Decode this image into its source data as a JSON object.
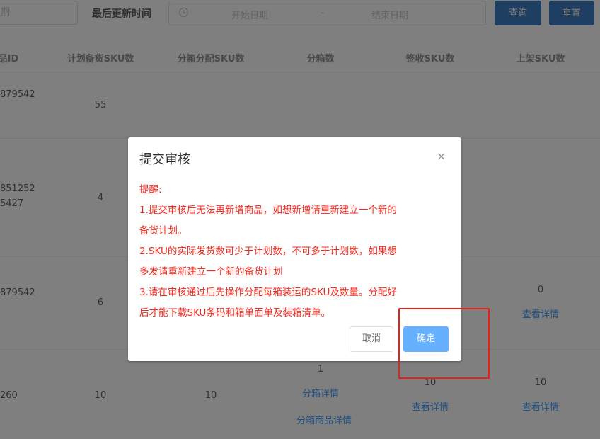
{
  "filter": {
    "partial_input": "期",
    "update_time_label": "最后更新时间",
    "start_placeholder": "开始日期",
    "range_separator": "-",
    "end_placeholder": "结束日期",
    "query_label": "查询",
    "reset_label": "重置"
  },
  "table": {
    "headers": [
      "品ID",
      "计划备货SKU数",
      "分箱分配SKU数",
      "分箱数",
      "签收SKU数",
      "上架SKU数"
    ],
    "rows": [
      {
        "id": "879542",
        "plan_sku": "55"
      },
      {
        "id_line1": "851252",
        "id_line2": "5427",
        "plan_sku": "4"
      },
      {
        "id": "879542",
        "plan_sku": "6",
        "shelf_sku": "0",
        "shelf_link": "查看详情"
      },
      {
        "id": "260",
        "plan_sku": "10",
        "alloc_sku": "10",
        "box_count": "1",
        "box_detail_link": "分箱详情",
        "box_goods_link": "分箱商品详情",
        "sign_sku": "10",
        "sign_link": "查看详情",
        "shelf_sku": "10",
        "shelf_link": "查看详情"
      }
    ]
  },
  "dialog": {
    "title": "提交审核",
    "close_icon": "×",
    "lines": [
      "提醒:",
      "1.提交审核后无法再新增商品，如想新增请重新建立一个新的",
      "备货计划。",
      "2.SKU的实际发货数可少于计划数，不可多于计划数，如果想",
      "多发请重新建立一个新的备货计划",
      "3.请在审核通过后先操作分配每箱装运的SKU及数量。分配好",
      "后才能下载SKU条码和箱单面单及装箱清单。"
    ],
    "cancel_label": "取消",
    "confirm_label": "确定",
    "text_color": "#f52b1e",
    "confirm_color": "#66b1ff"
  }
}
